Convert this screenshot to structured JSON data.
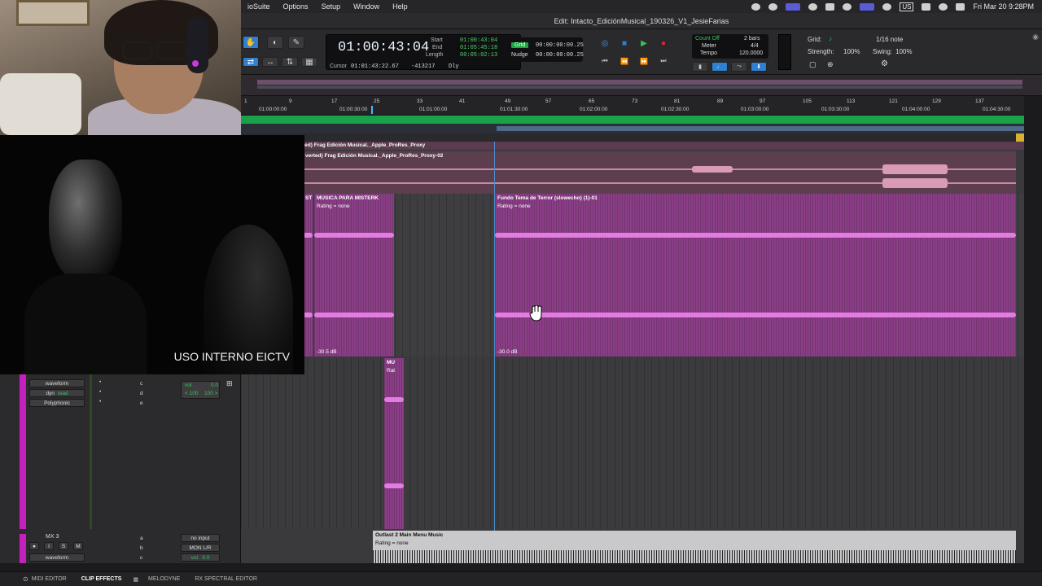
{
  "menubar": {
    "app_menu": "ioSuite",
    "items": [
      "Options",
      "Setup",
      "Window",
      "Help"
    ],
    "keyboard_layout": "US",
    "clock": "Fri Mar 20  9:28PM"
  },
  "window": {
    "title": "Edit: Intacto_EdiciónMusical_190326_V1_JesieFarias"
  },
  "counter": {
    "main": "01:00:43:04",
    "start_label": "Start",
    "end_label": "End",
    "length_label": "Length",
    "start": "01:00:43:04",
    "end": "01:05:45:18",
    "length": "00:05:02:13",
    "cursor_label": "Cursor",
    "cursor": "01:01:43:22.67",
    "cursor_offset": "-413217",
    "dly": "Dly"
  },
  "grid_nudge": {
    "grid_label": "Grid",
    "grid_value": "00:00:00:00.25",
    "nudge_label": "Nudge",
    "nudge_value": "00:00:00:00.25"
  },
  "countoff": {
    "count_off": "Count Off",
    "meter": "Meter",
    "tempo": "Tempo",
    "bars": "2 bars",
    "meter_value": "4/4",
    "tempo_value": "120.0000"
  },
  "grid_panel": {
    "grid": "Grid:",
    "note": "1/16 note",
    "strength": "Strength:",
    "strength_value": "100%",
    "swing": "Swing:",
    "swing_value": "100%"
  },
  "ruler": {
    "bars": [
      "1",
      "9",
      "17",
      "25",
      "33",
      "41",
      "49",
      "57",
      "65",
      "73",
      "81",
      "89",
      "97",
      "105",
      "113",
      "121",
      "129",
      "137"
    ],
    "timecodes": [
      "01:00:00:00",
      "01:00:30:00",
      "01:01:00:00",
      "01:01:30:00",
      "01:02:00:00",
      "01:02:30:00",
      "01:03:00:00",
      "01:03:30:00",
      "01:04:00:00",
      "01:04:30:00"
    ]
  },
  "clips": {
    "proxy_header": "ted) Frag Edición Musical._Apple_ProRes_Proxy",
    "proxy_02": "verted) Frag Edición Musical._Apple_ProRes_Proxy-02",
    "st": "ST",
    "musica": "MUSICA PARA MISTERK",
    "musica_rating": "Rating = none",
    "musica_db": "-30.5 dB",
    "fundo": "Fundo Tema de Terror (slowecho) (1)-01",
    "fundo_rating": "Rating = none",
    "fundo_db": "-30.0 dB",
    "small_name": "MU",
    "small_rating": "Rat",
    "outlast": "Outlast 2 Main Menu Music",
    "outlast_rating": "Rating = none"
  },
  "left_panel": {
    "waveform": "waveform",
    "dyn": "dyn",
    "read": "read",
    "polyphonic": "Polyphonic",
    "vol_label": "vol",
    "vol_value": "0.0",
    "pan_left": "< 100",
    "pan_right": "100 >",
    "send_c": "c",
    "send_d": "d",
    "send_e": "e",
    "track_mx3": "MX 3",
    "btn_i": "I",
    "btn_s": "S",
    "btn_m": "M",
    "no_input": "no input",
    "mon_lr": "MON L/R",
    "waveform2": "waveform",
    "send_a": "a",
    "send_b": "b",
    "send_c2": "c",
    "vol2_label": "vol",
    "vol2_value": "0.0"
  },
  "video": {
    "caption": "USO INTERNO EICTV"
  },
  "bottom_tabs": [
    "MIDI EDITOR",
    "CLIP EFFECTS",
    "MELODYNE",
    "RX SPECTRAL EDITOR"
  ],
  "colors": {
    "clip_pink": "#8a3e86",
    "waveform": "#e27ce0",
    "marker_green": "#1aa24a",
    "selection_blue": "#2f7fd2",
    "track_magenta": "#c51fbf"
  }
}
